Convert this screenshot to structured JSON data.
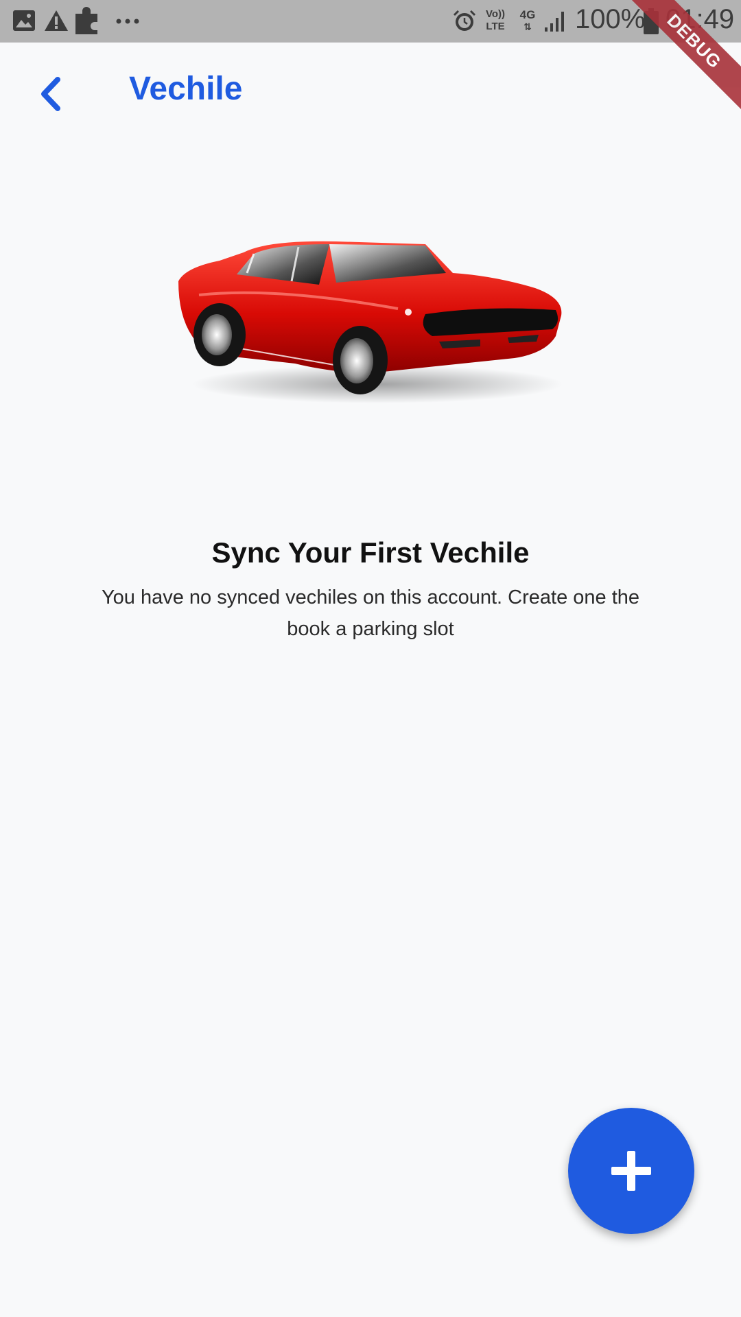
{
  "status_bar": {
    "icons": [
      "image-icon",
      "warning-icon",
      "puzzle-icon",
      "more-dots-icon",
      "alarm-icon",
      "volte-icon",
      "4g-icon",
      "signal-icon",
      "battery-icon"
    ],
    "volte_label": "Vo)) LTE",
    "network_label": "4G",
    "battery_percent": "100%",
    "time": "01:49",
    "debug_label": "DEBUG"
  },
  "app_bar": {
    "title": "Vechile",
    "back_icon": "chevron-left-icon"
  },
  "empty_state": {
    "illustration": "red-car-illustration",
    "title": "Sync Your First Vechile",
    "description": "You have no synced vechiles on this account. Create one the book a parking slot"
  },
  "fab": {
    "icon": "plus-icon"
  },
  "colors": {
    "accent": "#1f5be0",
    "status_bar_bg": "#b3b3b3",
    "background": "#f8f9fa",
    "debug_ribbon": "#a8323a"
  }
}
